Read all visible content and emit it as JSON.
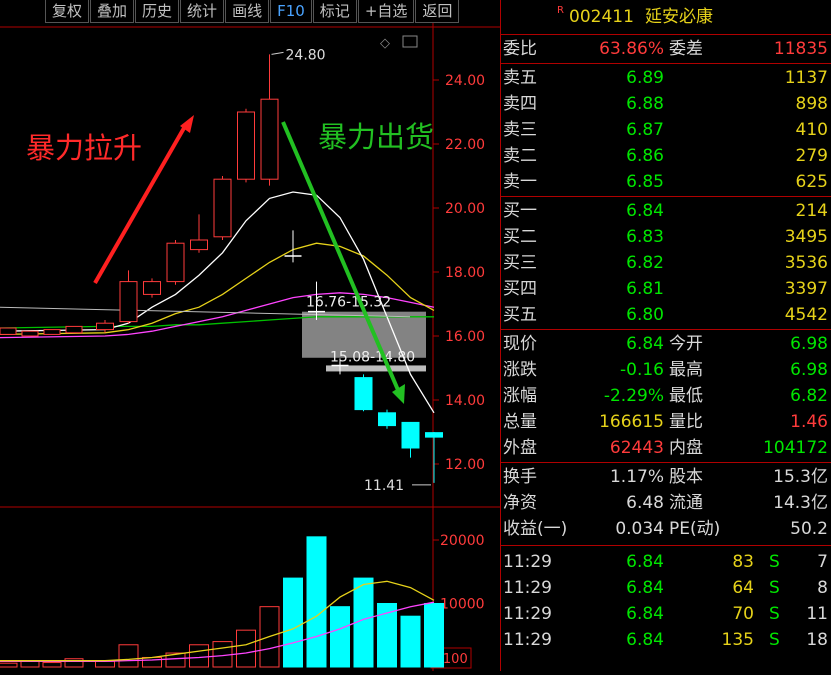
{
  "toolbar": [
    "复权",
    "叠加",
    "历史",
    "统计",
    "画线",
    "F10",
    "标记",
    "+自选",
    "返回"
  ],
  "stock": {
    "badge": "R",
    "code": "002411",
    "name": "延安必康"
  },
  "annotations": {
    "pump": "暴力拉升",
    "dump": "暴力出货"
  },
  "price_axis": [
    "24.00",
    "22.00",
    "20.00",
    "18.00",
    "16.00",
    "14.00",
    "12.00"
  ],
  "volume_axis": [
    "20000",
    "10000"
  ],
  "volume_unit": "X100",
  "chart_labels": {
    "high": "24.80",
    "low": "11.41",
    "range1": "16.76-15.32",
    "range2": "15.08-14.80"
  },
  "colors": {
    "up": "#ff3b3b",
    "down": "#00ffff",
    "ma5": "#ffffff",
    "ma10": "#e6d21a",
    "ma20": "#ff44ff",
    "ma60": "#00c000",
    "arrow_up": "#ff2020",
    "arrow_down": "#22c022"
  },
  "chart_data": {
    "type": "candlestick",
    "candles": [
      {
        "o": 16.2,
        "c": 16.4,
        "h": 16.5,
        "l": 16.1,
        "v": 900
      },
      {
        "o": 16.45,
        "c": 17.7,
        "h": 18.05,
        "l": 16.4,
        "v": 3500
      },
      {
        "o": 17.3,
        "c": 17.7,
        "h": 17.8,
        "l": 17.2,
        "v": 1500
      },
      {
        "o": 17.7,
        "c": 18.9,
        "h": 19.0,
        "l": 17.6,
        "v": 2200
      },
      {
        "o": 18.7,
        "c": 19.0,
        "h": 19.8,
        "l": 18.6,
        "v": 3500
      },
      {
        "o": 19.1,
        "c": 20.9,
        "h": 21.0,
        "l": 19.0,
        "v": 4000
      },
      {
        "o": 20.9,
        "c": 23.0,
        "h": 23.1,
        "l": 20.8,
        "v": 5800
      },
      {
        "o": 20.9,
        "c": 23.4,
        "h": 24.8,
        "l": 20.7,
        "v": 9500
      },
      {
        "o": 18.5,
        "c": 18.5,
        "h": 19.3,
        "l": 18.3,
        "v": 14000
      },
      {
        "o": 16.76,
        "c": 16.76,
        "h": 17.7,
        "l": 16.5,
        "v": 20500
      },
      {
        "o": 15.08,
        "c": 15.08,
        "h": 15.3,
        "l": 14.8,
        "v": 9500
      },
      {
        "o": 14.7,
        "c": 13.7,
        "h": 14.8,
        "l": 13.65,
        "v": 14000
      },
      {
        "o": 13.6,
        "c": 13.2,
        "h": 13.7,
        "l": 13.1,
        "v": 10000
      },
      {
        "o": 13.3,
        "c": 12.5,
        "h": 13.3,
        "l": 12.2,
        "v": 8000
      },
      {
        "o": 12.98,
        "c": 12.84,
        "h": 13.0,
        "l": 11.41,
        "v": 10000
      }
    ],
    "ma": {
      "ma5": [
        16.2,
        16.4,
        16.9,
        17.3,
        17.9,
        18.6,
        19.6,
        20.3,
        20.5,
        20.4,
        19.7,
        18.4,
        16.6,
        14.8,
        13.6
      ],
      "ma10": [
        16.1,
        16.2,
        16.4,
        16.7,
        16.9,
        17.3,
        17.8,
        18.3,
        18.7,
        18.9,
        18.8,
        18.5,
        17.9,
        17.2,
        16.8
      ],
      "ma20": [
        16.0,
        16.05,
        16.15,
        16.3,
        16.45,
        16.6,
        16.8,
        17.0,
        17.2,
        17.3,
        17.35,
        17.3,
        17.2,
        17.05,
        16.9
      ],
      "ma60": [
        16.3,
        16.3,
        16.3,
        16.35,
        16.35,
        16.4,
        16.45,
        16.5,
        16.55,
        16.6,
        16.6,
        16.6,
        16.6,
        16.6,
        16.6
      ]
    },
    "vol_ma": {
      "ma5": [
        1000,
        1200,
        1500,
        2000,
        2500,
        3000,
        3500,
        4800,
        6000,
        8000,
        11000,
        13000,
        13500,
        12500,
        10500
      ],
      "ma10": [
        900,
        1000,
        1100,
        1300,
        1500,
        1800,
        2200,
        2900,
        3800,
        4800,
        6000,
        7500,
        8500,
        9500,
        10200
      ]
    },
    "price_ylim": [
      11,
      25.5
    ],
    "volume_ylim": [
      0,
      22000
    ]
  },
  "panel_top": [
    {
      "label": "委比",
      "value": "63.86%",
      "label2": "委差",
      "value2": "11835"
    }
  ],
  "sells": [
    {
      "label": "卖五",
      "price": "6.89",
      "qty": "1137"
    },
    {
      "label": "卖四",
      "price": "6.88",
      "qty": "898"
    },
    {
      "label": "卖三",
      "price": "6.87",
      "qty": "410"
    },
    {
      "label": "卖二",
      "price": "6.86",
      "qty": "279"
    },
    {
      "label": "卖一",
      "price": "6.85",
      "qty": "625"
    }
  ],
  "buys": [
    {
      "label": "买一",
      "price": "6.84",
      "qty": "214"
    },
    {
      "label": "买二",
      "price": "6.83",
      "qty": "3495"
    },
    {
      "label": "买三",
      "price": "6.82",
      "qty": "3536"
    },
    {
      "label": "买四",
      "price": "6.81",
      "qty": "3397"
    },
    {
      "label": "买五",
      "price": "6.80",
      "qty": "4542"
    }
  ],
  "quote": [
    {
      "l1": "现价",
      "v1": "6.84",
      "c1": "green",
      "l2": "今开",
      "v2": "6.98",
      "c2": "green"
    },
    {
      "l1": "涨跌",
      "v1": "-0.16",
      "c1": "green",
      "l2": "最高",
      "v2": "6.98",
      "c2": "green"
    },
    {
      "l1": "涨幅",
      "v1": "-2.29%",
      "c1": "green",
      "l2": "最低",
      "v2": "6.82",
      "c2": "green"
    },
    {
      "l1": "总量",
      "v1": "166615",
      "c1": "yellow",
      "l2": "量比",
      "v2": "1.46",
      "c2": "red"
    },
    {
      "l1": "外盘",
      "v1": "62443",
      "c1": "red",
      "l2": "内盘",
      "v2": "104172",
      "c2": "green"
    }
  ],
  "fundamentals": [
    {
      "l1": "换手",
      "v1": "1.17%",
      "l2": "股本",
      "v2": "15.3亿"
    },
    {
      "l1": "净资",
      "v1": "6.48",
      "l2": "流通",
      "v2": "14.3亿"
    },
    {
      "l1": "收益(一)",
      "v1": "0.034",
      "l2": "PE(动)",
      "v2": "50.2"
    }
  ],
  "ticks": [
    {
      "time": "11:29",
      "price": "6.84",
      "vol": "83",
      "side": "S",
      "n": "7"
    },
    {
      "time": "11:29",
      "price": "6.84",
      "vol": "64",
      "side": "S",
      "n": "8"
    },
    {
      "time": "11:29",
      "price": "6.84",
      "vol": "70",
      "side": "S",
      "n": "11"
    },
    {
      "time": "11:29",
      "price": "6.84",
      "vol": "135",
      "side": "S",
      "n": "18"
    }
  ]
}
